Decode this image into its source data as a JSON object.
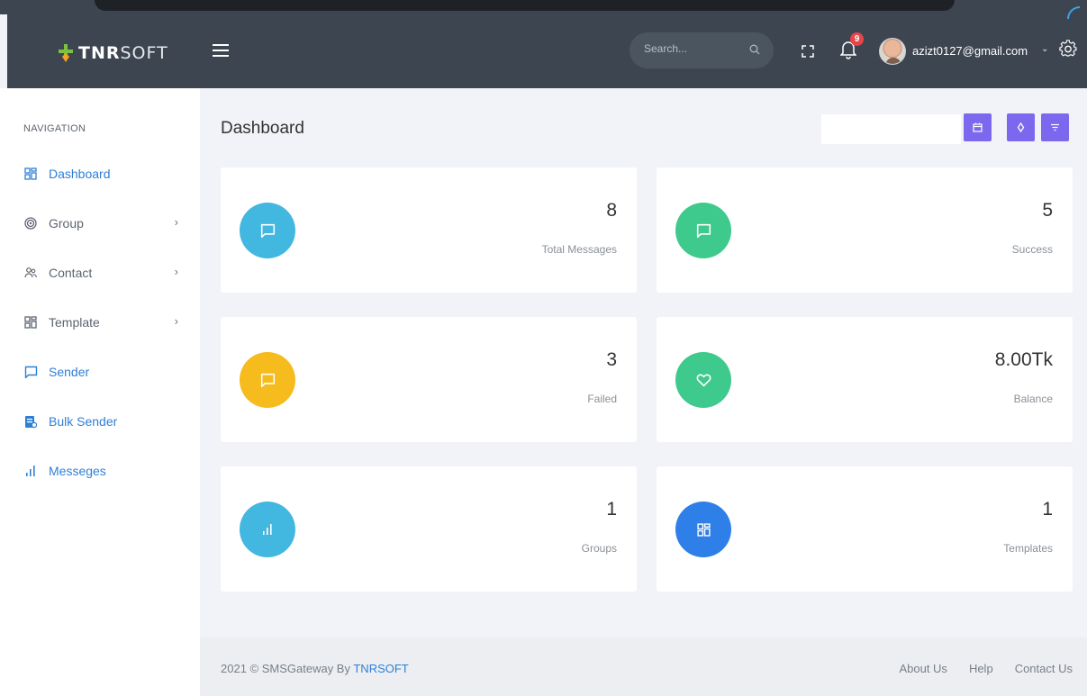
{
  "header": {
    "logo_bold": "TNR",
    "logo_light": "SOFT",
    "search_placeholder": "Search...",
    "notification_count": "9",
    "user_email": "azizt0127@gmail.com"
  },
  "sidebar": {
    "heading": "NAVIGATION",
    "items": [
      {
        "label": "Dashboard",
        "icon": "grid-icon",
        "has_submenu": false
      },
      {
        "label": "Group",
        "icon": "target-icon",
        "has_submenu": true
      },
      {
        "label": "Contact",
        "icon": "users-icon",
        "has_submenu": true
      },
      {
        "label": "Template",
        "icon": "grid-icon",
        "has_submenu": true
      },
      {
        "label": "Sender",
        "icon": "message-icon",
        "has_submenu": false
      },
      {
        "label": "Bulk Sender",
        "icon": "document-icon",
        "has_submenu": false
      },
      {
        "label": "Messeges",
        "icon": "bar-chart-icon",
        "has_submenu": false
      }
    ]
  },
  "main": {
    "title": "Dashboard",
    "stats": [
      {
        "value": "8",
        "label": "Total Messages",
        "icon": "message-icon",
        "color": "#42b7e0"
      },
      {
        "value": "5",
        "label": "Success",
        "icon": "message-icon",
        "color": "#3fca8d"
      },
      {
        "value": "3",
        "label": "Failed",
        "icon": "message-icon",
        "color": "#f6bb1c"
      },
      {
        "value": "8.00Tk",
        "label": "Balance",
        "icon": "heart-icon",
        "color": "#3fca8d"
      },
      {
        "value": "1",
        "label": "Groups",
        "icon": "bar-chart-icon",
        "color": "#42b7e0"
      },
      {
        "value": "1",
        "label": "Templates",
        "icon": "grid-icon",
        "color": "#2f7fe8"
      }
    ]
  },
  "footer": {
    "copyright": "2021 © SMSGateway By ",
    "brand": "TNRSOFT",
    "links": [
      "About Us",
      "Help",
      "Contact Us"
    ]
  },
  "colors": {
    "header_bg": "#3d4650",
    "accent_purple": "#7c68ee",
    "link_blue": "#2f7fd6"
  }
}
